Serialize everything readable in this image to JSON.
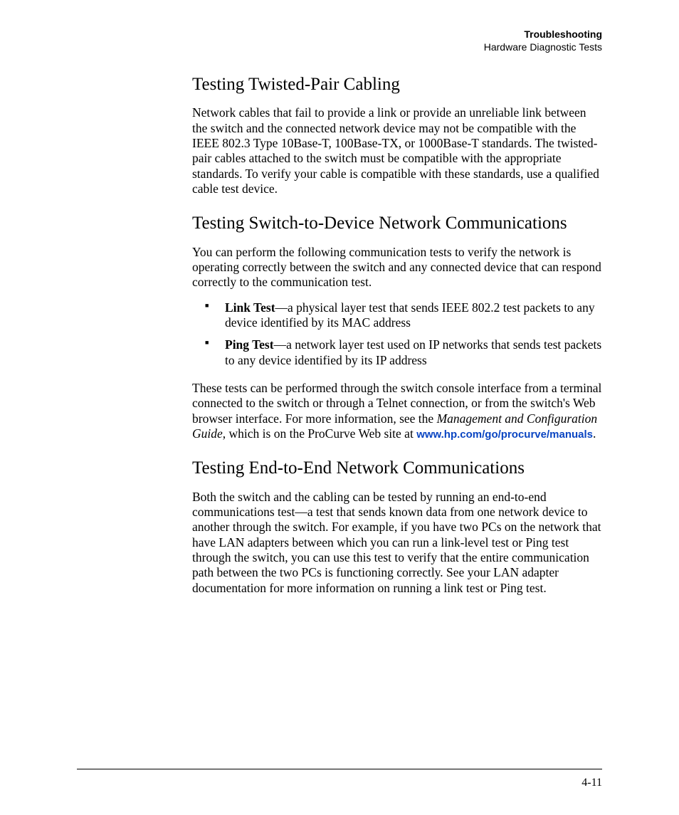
{
  "header": {
    "chapter": "Troubleshooting",
    "section": "Hardware Diagnostic Tests"
  },
  "sections": {
    "twistedPair": {
      "title": "Testing Twisted-Pair Cabling",
      "body": "Network cables that fail to provide a link or provide an unreliable link between the switch and the connected network device may not be compatible with the IEEE 802.3 Type 10Base-T, 100Base-TX, or 1000Base-T standards. The twisted-pair cables attached to the switch must be compatible with the appropriate standards. To verify your cable is compatible with these standards, use a qualified cable test device."
    },
    "switchToDevice": {
      "title": "Testing Switch-to-Device Network Communications",
      "intro": "You can perform the following communication tests to verify the network is operating correctly between the switch and any connected device that can respond correctly to the communication test.",
      "bullets": [
        {
          "term": "Link Test",
          "def": "—a physical layer test that sends IEEE 802.2 test packets to any device identified by its MAC address"
        },
        {
          "term": "Ping Test",
          "def": "—a network layer test used on IP networks that sends test packets to any device identified by its IP address"
        }
      ],
      "after_pre": "These tests can be performed through the switch console interface from a terminal connected to the switch or through a Telnet connection, or from the switch's Web browser interface. For more information, see the ",
      "guide_title": "Management and Configuration Guide",
      "after_mid": ", which is on the ProCurve Web site at ",
      "link": "www.hp.com/go/procurve/manuals",
      "after_post": "."
    },
    "endToEnd": {
      "title": "Testing End-to-End Network Communications",
      "body": "Both the switch and the cabling can be tested by running an end-to-end communications test—a test that sends known data from one network device to another through the switch. For example, if you have two PCs on the network that have LAN adapters between which you can run a link-level test or Ping test through the switch, you can use this test to verify that the entire communication path between the two PCs is functioning correctly. See your LAN adapter documentation for more information on running a link test or Ping test."
    }
  },
  "pageNumber": "4-11"
}
